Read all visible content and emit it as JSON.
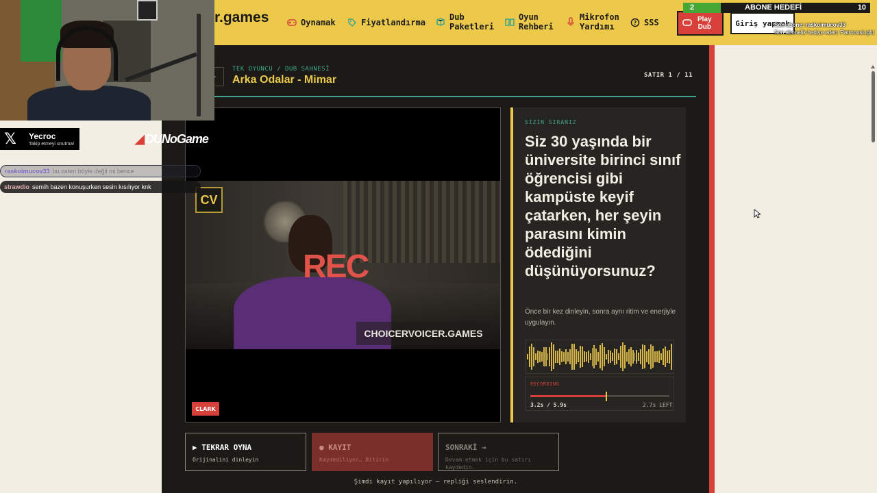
{
  "header": {
    "logo": "r.games",
    "nav": [
      {
        "label": "Oynamak",
        "icon": "gamepad-icon"
      },
      {
        "label": "Fiyatlandırma",
        "icon": "tag-icon"
      },
      {
        "label": "Dub\nPaketleri",
        "icon": "package-icon"
      },
      {
        "label": "Oyun\nRehberi",
        "icon": "book-icon"
      },
      {
        "label": "Mikrofon\nYardımı",
        "icon": "microphone-icon"
      },
      {
        "label": "SSS",
        "icon": "help-icon"
      }
    ],
    "play_dub": "Play\nDub",
    "login": "Giriş yapmak"
  },
  "overlay": {
    "goal_current": "2",
    "goal_title": "ABONE HEDEFİ",
    "goal_target": "10",
    "goal_progress": 0.2,
    "last_sub": "Son abone: raskoimucov33",
    "last_gift": "Son abonelik hediye eden: PatronusLight"
  },
  "scene": {
    "crumb": "TEK OYUNCU / DUB SAHNESİ",
    "title": "Arka Odalar - Mimar",
    "line_count": "SATIR 1 / 11",
    "back_icon": "arrow-left-icon"
  },
  "video": {
    "logo": "CV",
    "rec": "REC",
    "watermark": "CHOICERVOICER.GAMES",
    "character": "CLARK"
  },
  "prompt": {
    "label": "SİZİN SIRANIZ",
    "question": "Siz 30 yaşında bir üniversite birinci sınıf öğrencisi gibi kampüste keyif çatarken, her şeyin parasını kimin ödediğini düşünüyorsunuz?",
    "hint": "Önce bir kez dinleyin, sonra aynı ritim ve enerjiyle uygulayın.",
    "recording_label": "RECORDING",
    "elapsed": "3.2s / 5.9s",
    "left": "2.7s LEFT",
    "progress": 0.54
  },
  "actions": [
    {
      "title": "▶ TEKRAR OYNA",
      "sub": "Orijinalini dinleyin"
    },
    {
      "title": "● KAYIT",
      "sub": "Kaydediliyor… Bitirin"
    },
    {
      "title": "SONRAKİ →",
      "sub": "Devam etmek için bu satırı kaydedin."
    }
  ],
  "status": "Şimdi kayıt yapılıyor — repliği seslendirin.",
  "social": {
    "name": "Yecroc",
    "tagline": "Takip etmeyi unutma!",
    "brand": "DUNoGame"
  },
  "chat": [
    {
      "user": "raskoimucov33",
      "text": "bu zaten böyle değil mi bence",
      "user_color": "#7b6cc9"
    },
    {
      "user": "strawdio",
      "text": "semih bazen konuşurken sesin kısılıyor knk",
      "user_color": "#e0b0b0"
    }
  ],
  "colors": {
    "accent_yellow": "#ecc94b",
    "accent_red": "#d8403a",
    "accent_teal": "#3fa48c",
    "dark_bg": "#1b1a17"
  }
}
